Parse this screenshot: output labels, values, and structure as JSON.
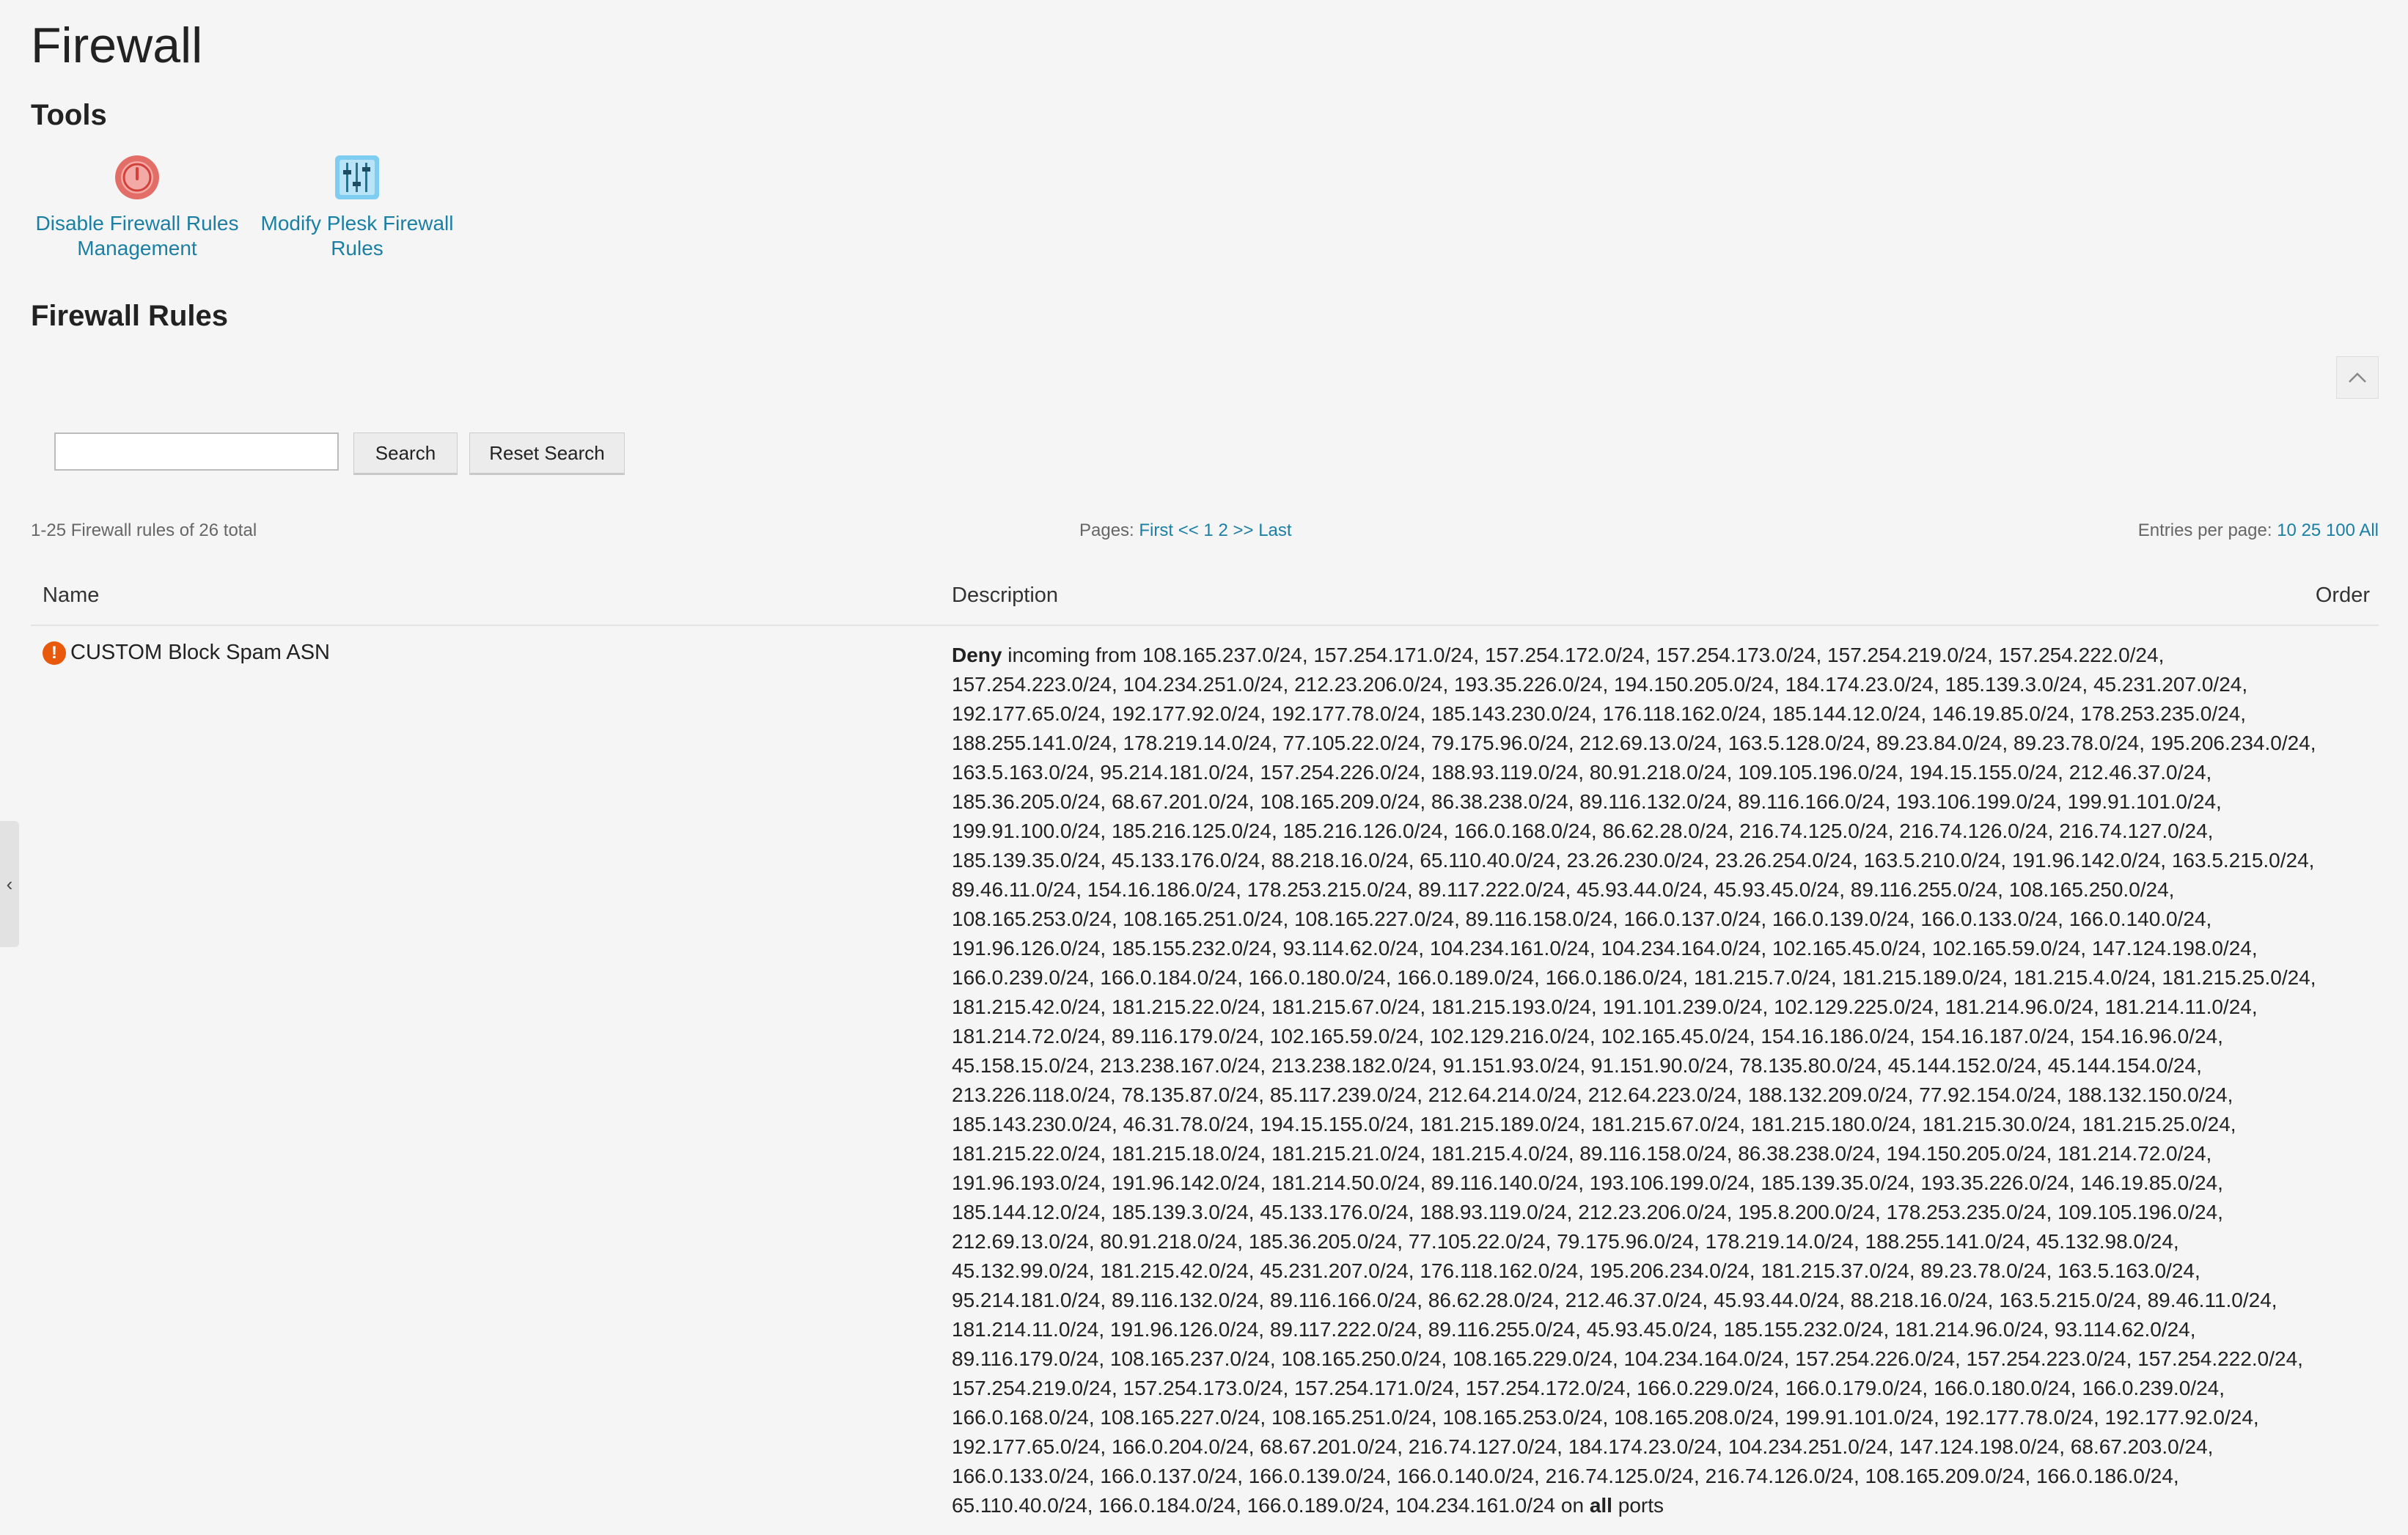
{
  "page": {
    "title": "Firewall"
  },
  "tools": {
    "heading": "Tools",
    "items": [
      {
        "label_line1": "Disable Firewall Rules",
        "label_line2": "Management",
        "icon": "power-off-icon"
      },
      {
        "label_line1": "Modify Plesk Firewall",
        "label_line2": "Rules",
        "icon": "sliders-icon"
      }
    ]
  },
  "rules": {
    "heading": "Firewall Rules",
    "search": {
      "value": "",
      "placeholder": "",
      "search_label": "Search",
      "reset_label": "Reset Search"
    },
    "summary": "1-25 Firewall rules of 26 total",
    "pages": {
      "label": "Pages:",
      "first": "First",
      "prev": "<<",
      "p1": "1",
      "p2": "2",
      "next": ">>",
      "last": "Last"
    },
    "entries": {
      "label": "Entries per page:",
      "o10": "10",
      "o25": "25",
      "o100": "100",
      "all": "All"
    },
    "columns": {
      "name": "Name",
      "description": "Description",
      "order": "Order"
    },
    "row": {
      "name": "CUSTOM Block Spam ASN",
      "action": "Deny",
      "direction": "incoming from",
      "lines": [
        "108.165.237.0/24, 157.254.171.0/24, 157.254.172.0/24, 157.254.173.0/24, 157.254.219.0/24, 157.254.222.0/24,",
        "157.254.223.0/24, 104.234.251.0/24, 212.23.206.0/24, 193.35.226.0/24, 194.150.205.0/24, 184.174.23.0/24, 185.139.3.0/24, 45.231.207.0/24,",
        "192.177.65.0/24, 192.177.92.0/24, 192.177.78.0/24, 185.143.230.0/24, 176.118.162.0/24, 185.144.12.0/24, 146.19.85.0/24, 178.253.235.0/24,",
        "188.255.141.0/24, 178.219.14.0/24, 77.105.22.0/24, 79.175.96.0/24, 212.69.13.0/24, 163.5.128.0/24, 89.23.84.0/24, 89.23.78.0/24, 195.206.234.0/24,",
        "163.5.163.0/24, 95.214.181.0/24, 157.254.226.0/24, 188.93.119.0/24, 80.91.218.0/24, 109.105.196.0/24, 194.15.155.0/24, 212.46.37.0/24,",
        "185.36.205.0/24, 68.67.201.0/24, 108.165.209.0/24, 86.38.238.0/24, 89.116.132.0/24, 89.116.166.0/24, 193.106.199.0/24, 199.91.101.0/24,",
        "199.91.100.0/24, 185.216.125.0/24, 185.216.126.0/24, 166.0.168.0/24, 86.62.28.0/24, 216.74.125.0/24, 216.74.126.0/24, 216.74.127.0/24,",
        "185.139.35.0/24, 45.133.176.0/24, 88.218.16.0/24, 65.110.40.0/24, 23.26.230.0/24, 23.26.254.0/24, 163.5.210.0/24, 191.96.142.0/24, 163.5.215.0/24,",
        "89.46.11.0/24, 154.16.186.0/24, 178.253.215.0/24, 89.117.222.0/24, 45.93.44.0/24, 45.93.45.0/24, 89.116.255.0/24, 108.165.250.0/24,",
        "108.165.253.0/24, 108.165.251.0/24, 108.165.227.0/24, 89.116.158.0/24, 166.0.137.0/24, 166.0.139.0/24, 166.0.133.0/24, 166.0.140.0/24,",
        "191.96.126.0/24, 185.155.232.0/24, 93.114.62.0/24, 104.234.161.0/24, 104.234.164.0/24, 102.165.45.0/24, 102.165.59.0/24, 147.124.198.0/24,",
        "166.0.239.0/24, 166.0.184.0/24, 166.0.180.0/24, 166.0.189.0/24, 166.0.186.0/24, 181.215.7.0/24, 181.215.189.0/24, 181.215.4.0/24, 181.215.25.0/24,",
        "181.215.42.0/24, 181.215.22.0/24, 181.215.67.0/24, 181.215.193.0/24, 191.101.239.0/24, 102.129.225.0/24, 181.214.96.0/24, 181.214.11.0/24,",
        "181.214.72.0/24, 89.116.179.0/24, 102.165.59.0/24, 102.129.216.0/24, 102.165.45.0/24, 154.16.186.0/24, 154.16.187.0/24, 154.16.96.0/24,",
        "45.158.15.0/24, 213.238.167.0/24, 213.238.182.0/24, 91.151.93.0/24, 91.151.90.0/24, 78.135.80.0/24, 45.144.152.0/24, 45.144.154.0/24,",
        "213.226.118.0/24, 78.135.87.0/24, 85.117.239.0/24, 212.64.214.0/24, 212.64.223.0/24, 188.132.209.0/24, 77.92.154.0/24, 188.132.150.0/24,",
        "185.143.230.0/24, 46.31.78.0/24, 194.15.155.0/24, 181.215.189.0/24, 181.215.67.0/24, 181.215.180.0/24, 181.215.30.0/24, 181.215.25.0/24,",
        "181.215.22.0/24, 181.215.18.0/24, 181.215.21.0/24, 181.215.4.0/24, 89.116.158.0/24, 86.38.238.0/24, 194.150.205.0/24, 181.214.72.0/24,",
        "191.96.193.0/24, 191.96.142.0/24, 181.214.50.0/24, 89.116.140.0/24, 193.106.199.0/24, 185.139.35.0/24, 193.35.226.0/24, 146.19.85.0/24,",
        "185.144.12.0/24, 185.139.3.0/24, 45.133.176.0/24, 188.93.119.0/24, 212.23.206.0/24, 195.8.200.0/24, 178.253.235.0/24, 109.105.196.0/24,",
        "212.69.13.0/24, 80.91.218.0/24, 185.36.205.0/24, 77.105.22.0/24, 79.175.96.0/24, 178.219.14.0/24, 188.255.141.0/24, 45.132.98.0/24,",
        "45.132.99.0/24, 181.215.42.0/24, 45.231.207.0/24, 176.118.162.0/24, 195.206.234.0/24, 181.215.37.0/24, 89.23.78.0/24, 163.5.163.0/24,",
        "95.214.181.0/24, 89.116.132.0/24, 89.116.166.0/24, 86.62.28.0/24, 212.46.37.0/24, 45.93.44.0/24, 88.218.16.0/24, 163.5.215.0/24, 89.46.11.0/24,",
        "181.214.11.0/24, 191.96.126.0/24, 89.117.222.0/24, 89.116.255.0/24, 45.93.45.0/24, 185.155.232.0/24, 181.214.96.0/24, 93.114.62.0/24,",
        "89.116.179.0/24, 108.165.237.0/24, 108.165.250.0/24, 108.165.229.0/24, 104.234.164.0/24, 157.254.226.0/24, 157.254.223.0/24, 157.254.222.0/24,",
        "157.254.219.0/24, 157.254.173.0/24, 157.254.171.0/24, 157.254.172.0/24, 166.0.229.0/24, 166.0.179.0/24, 166.0.180.0/24, 166.0.239.0/24,",
        "166.0.168.0/24, 108.165.227.0/24, 108.165.251.0/24, 108.165.253.0/24, 108.165.208.0/24, 199.91.101.0/24, 192.177.78.0/24, 192.177.92.0/24,",
        "192.177.65.0/24, 166.0.204.0/24, 68.67.201.0/24, 216.74.127.0/24, 184.174.23.0/24, 104.234.251.0/24, 147.124.198.0/24, 68.67.203.0/24,",
        "166.0.133.0/24, 166.0.137.0/24, 166.0.139.0/24, 166.0.140.0/24, 216.74.125.0/24, 216.74.126.0/24, 108.165.209.0/24, 166.0.186.0/24,",
        "65.110.40.0/24, 166.0.184.0/24, 166.0.189.0/24, 104.234.161.0/24"
      ],
      "on_word": "on",
      "ports_qual": "all",
      "ports_word": "ports"
    }
  },
  "colors": {
    "link": "#1b7fa3",
    "warning": "#e8590c",
    "background": "#f5f5f5"
  }
}
